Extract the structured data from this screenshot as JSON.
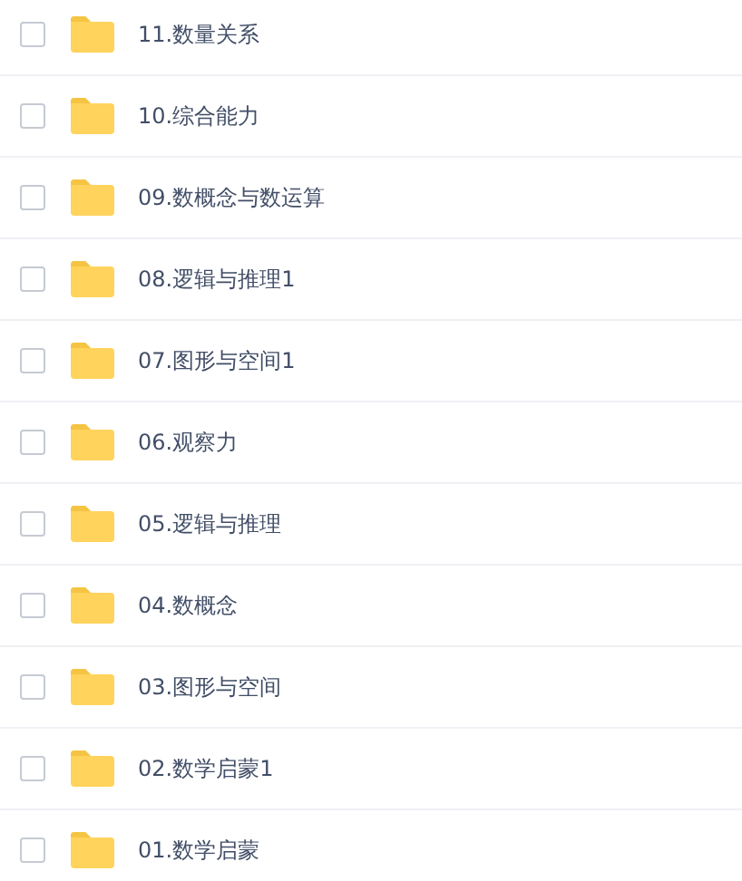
{
  "files": [
    {
      "name": "11.数量关系",
      "checked": false
    },
    {
      "name": "10.综合能力",
      "checked": false
    },
    {
      "name": "09.数概念与数运算",
      "checked": false
    },
    {
      "name": "08.逻辑与推理1",
      "checked": false
    },
    {
      "name": "07.图形与空间1",
      "checked": false
    },
    {
      "name": "06.观察力",
      "checked": false
    },
    {
      "name": "05.逻辑与推理",
      "checked": false
    },
    {
      "name": "04.数概念",
      "checked": false
    },
    {
      "name": "03.图形与空间",
      "checked": false
    },
    {
      "name": "02.数学启蒙1",
      "checked": false
    },
    {
      "name": "01.数学启蒙",
      "checked": false
    }
  ]
}
